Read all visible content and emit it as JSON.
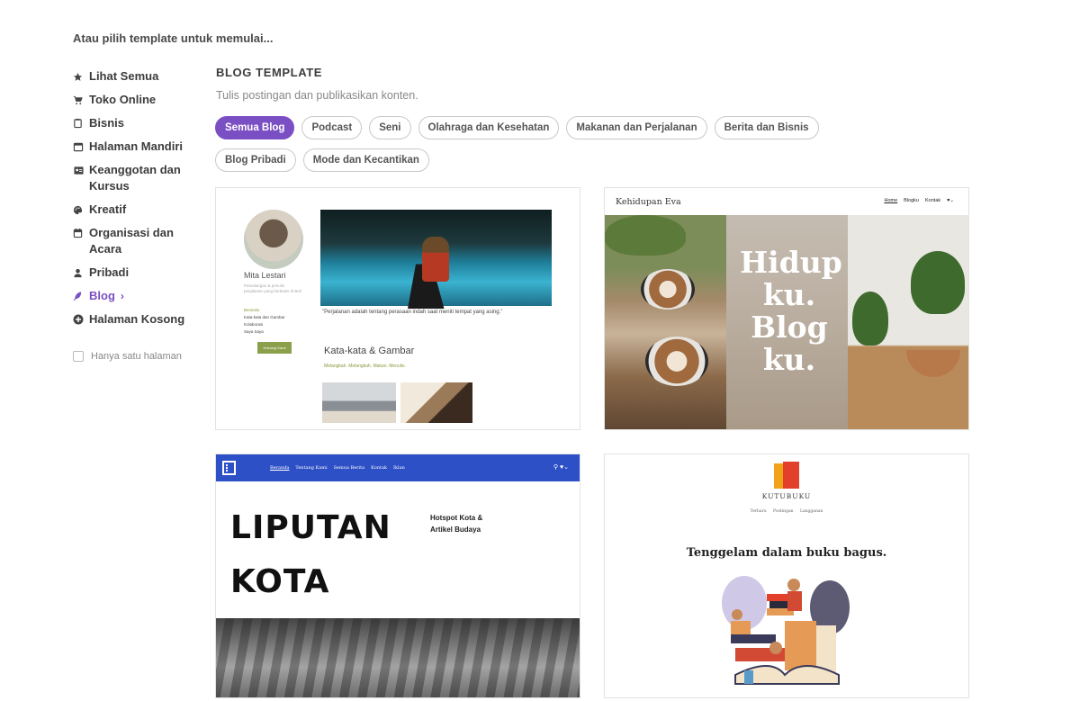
{
  "heading": "Atau pilih template untuk memulai...",
  "sidebar": {
    "items": [
      {
        "label": "Lihat Semua",
        "icon": "star-icon"
      },
      {
        "label": "Toko Online",
        "icon": "cart-icon"
      },
      {
        "label": "Bisnis",
        "icon": "clipboard-icon"
      },
      {
        "label": "Halaman Mandiri",
        "icon": "window-icon"
      },
      {
        "label": "Keanggotan dan Kursus",
        "icon": "id-card-icon"
      },
      {
        "label": "Kreatif",
        "icon": "palette-icon"
      },
      {
        "label": "Organisasi dan Acara",
        "icon": "calendar-icon"
      },
      {
        "label": "Pribadi",
        "icon": "user-icon"
      },
      {
        "label": "Blog",
        "icon": "feather-icon"
      },
      {
        "label": "Halaman Kosong",
        "icon": "plus-circle-icon"
      }
    ],
    "active_index": 8,
    "single_page_label": "Hanya satu halaman",
    "active_color": "#7b4fc4"
  },
  "section": {
    "title": "BLOG TEMPLATE",
    "subtitle": "Tulis postingan dan publikasikan konten."
  },
  "filters": {
    "chips": [
      "Semua Blog",
      "Podcast",
      "Seni",
      "Olahraga dan Kesehatan",
      "Makanan dan Perjalanan",
      "Berita dan Bisnis",
      "Blog Pribadi",
      "Mode dan Kecantikan"
    ],
    "active": "Semua Blog"
  },
  "cards": {
    "c1": {
      "name": "Mita Lestari",
      "desc": "Petualangan & penulis perjalanan yang berbasis di Bali",
      "menu": [
        "Beranda",
        "Kata-kata dan Gambar",
        "Kolaborasi",
        "Saya Saya"
      ],
      "button": "Hubungi Kami",
      "quote": "\"Perjalanan adalah tentang perasaan indah saat meniti tempat yang asing.\"",
      "section_title": "Kata-kata & Gambar",
      "section_sub": "Melangkah. Melangkah. Makan. Menulis."
    },
    "c2": {
      "brand": "Kehidupan Eva",
      "nav": [
        "Home",
        "Blogku",
        "Kontak"
      ],
      "big_text": [
        "Hidup",
        "ku.",
        "Blog",
        "ku."
      ]
    },
    "c3": {
      "nav": [
        "Beranda",
        "Tentang Kami",
        "Semua Berita",
        "Kontak",
        "Iklan"
      ],
      "big": [
        "LIPUTAN",
        "KOTA"
      ],
      "side": [
        "Hotspot Kota &",
        "Artikel Budaya"
      ]
    },
    "c4": {
      "brand": "KUTUBUKU",
      "nav": "Terbaru Postingan Langganan",
      "tagline": "Tenggelam dalam buku bagus."
    }
  }
}
